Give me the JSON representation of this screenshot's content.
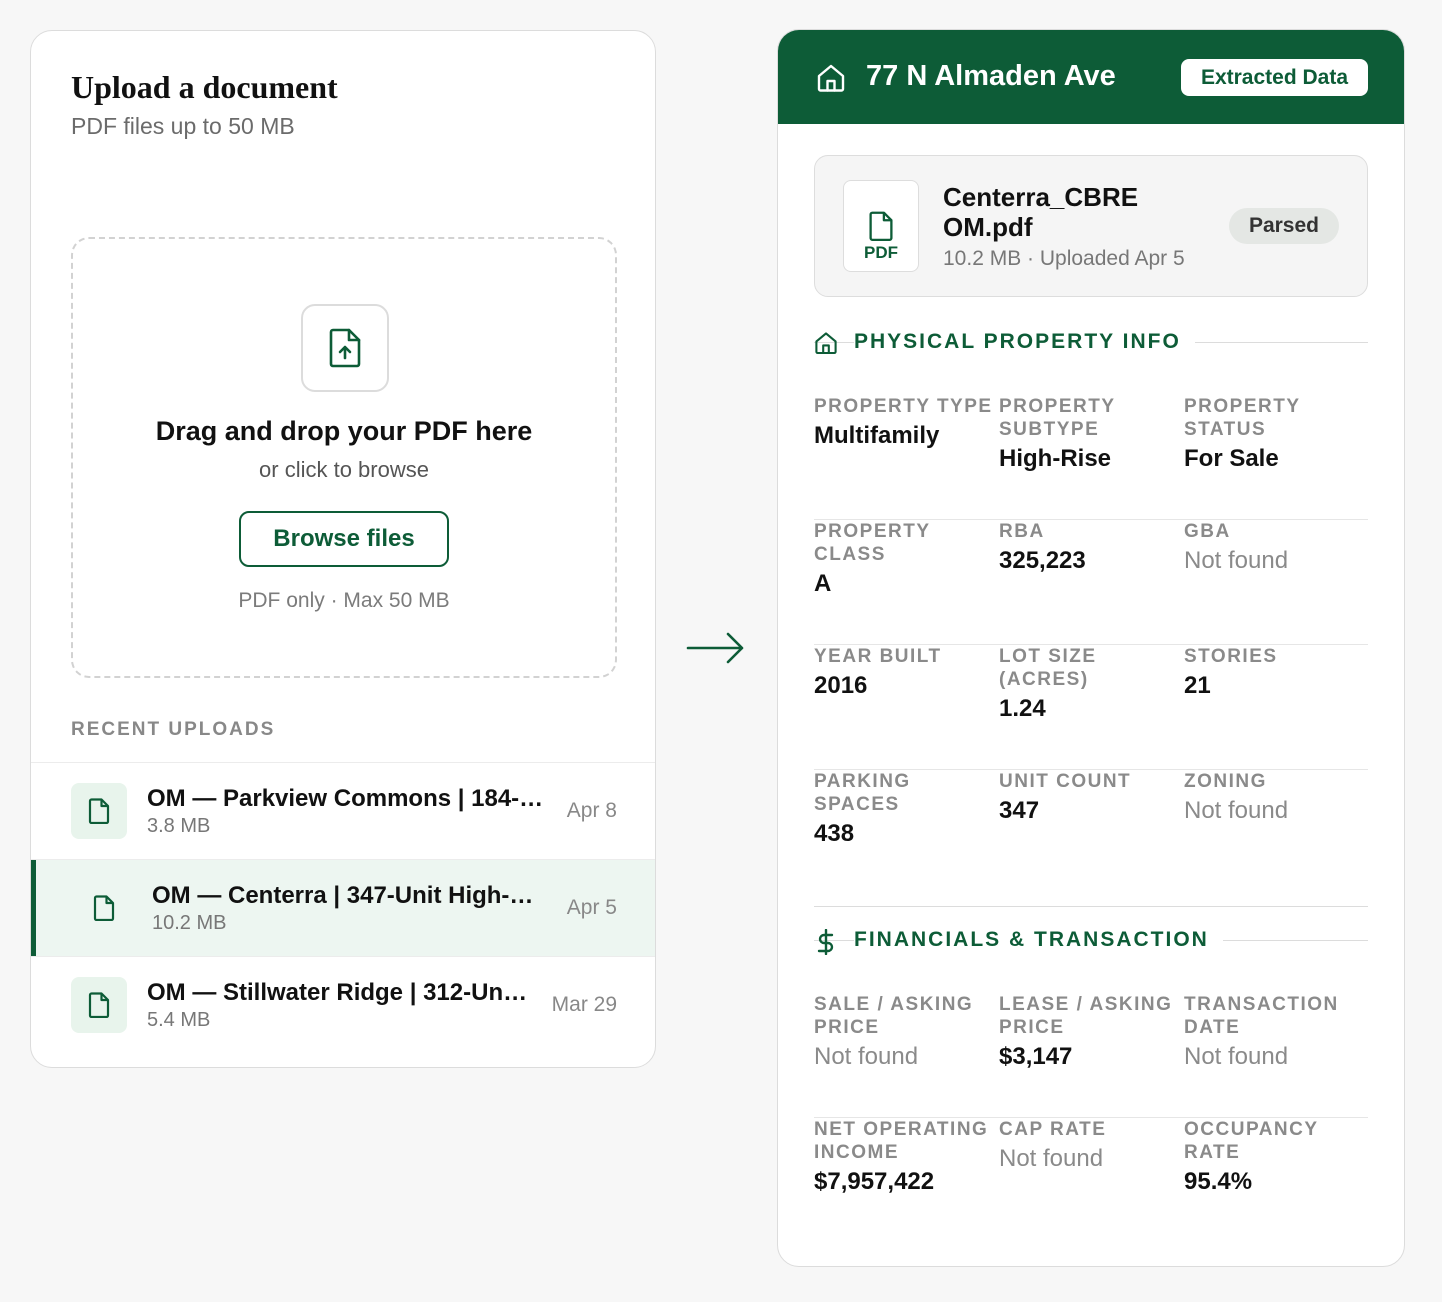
{
  "upload": {
    "title": "Upload a document",
    "subtitle": "PDF files up to 50 MB",
    "dropzone": {
      "title": "Drag and drop your PDF here",
      "subtitle": "or click to browse",
      "button": "Browse files",
      "note": "PDF only · Max 50 MB",
      "icon": "file-upload-icon"
    },
    "recent_title": "RECENT UPLOADS",
    "recent": [
      {
        "name": "OM — Parkview Commons | 184-…",
        "size": "3.8 MB",
        "date": "Apr 8",
        "active": false
      },
      {
        "name": "OM — Centerra | 347-Unit High-…",
        "size": "10.2 MB",
        "date": "Apr 5",
        "active": true
      },
      {
        "name": "OM — Stillwater Ridge | 312-Un…",
        "size": "5.4 MB",
        "date": "Mar 29",
        "active": false
      }
    ]
  },
  "extracted": {
    "address": "77 N Almaden Ave",
    "badge": "Extracted Data",
    "file": {
      "name": "Centerra_CBRE OM.pdf",
      "type": "PDF",
      "meta": "10.2 MB · Uploaded Apr 5",
      "status": "Parsed"
    },
    "physical": {
      "title": "PHYSICAL PROPERTY INFO",
      "icon": "home-icon",
      "rows": [
        [
          {
            "label": "PROPERTY TYPE",
            "value": "Multifamily"
          },
          {
            "label": "PROPERTY SUBTYPE",
            "value": "High-Rise"
          },
          {
            "label": "PROPERTY STATUS",
            "value": "For Sale"
          }
        ],
        [
          {
            "label": "PROPERTY CLASS",
            "value": "A"
          },
          {
            "label": "RBA",
            "value": "325,223"
          },
          {
            "label": "GBA",
            "value": "Not found"
          }
        ],
        [
          {
            "label": "YEAR BUILT",
            "value": "2016"
          },
          {
            "label": "LOT SIZE (ACRES)",
            "value": "1.24"
          },
          {
            "label": "STORIES",
            "value": "21"
          }
        ],
        [
          {
            "label": "PARKING SPACES",
            "value": "438"
          },
          {
            "label": "UNIT COUNT",
            "value": "347"
          },
          {
            "label": "ZONING",
            "value": "Not found"
          }
        ]
      ]
    },
    "financial": {
      "title": "FINANCIALS & TRANSACTION",
      "icon": "dollar-icon",
      "rows": [
        [
          {
            "label": "SALE / ASKING PRICE",
            "value": "Not found"
          },
          {
            "label": "LEASE / ASKING PRICE",
            "value": "$3,147"
          },
          {
            "label": "TRANSACTION DATE",
            "value": "Not found"
          }
        ],
        [
          {
            "label": "NET OPERATING INCOME",
            "value": "$7,957,422"
          },
          {
            "label": "CAP RATE",
            "value": "Not found"
          },
          {
            "label": "OCCUPANCY RATE",
            "value": "95.4%"
          }
        ]
      ]
    }
  },
  "colors": {
    "brand": "#0d5c37",
    "muted": "#8a8a8a",
    "active_bg": "#edf6f1"
  }
}
